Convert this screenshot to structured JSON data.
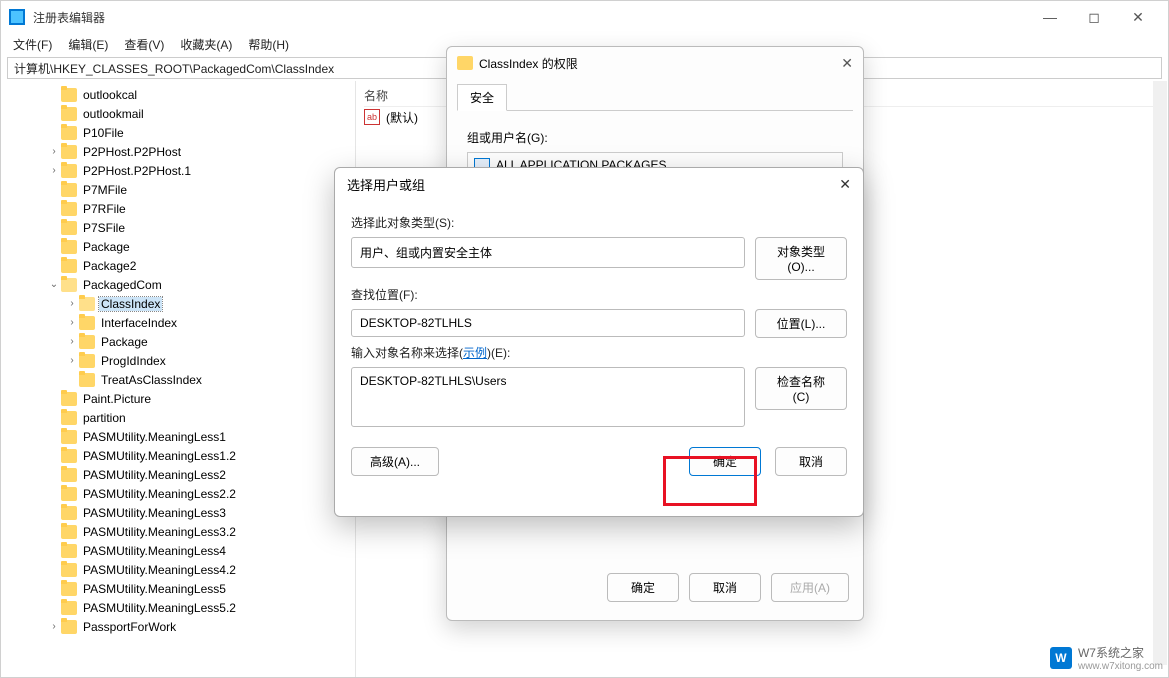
{
  "window": {
    "title": "注册表编辑器",
    "minimize": "—",
    "maximize": "◻",
    "close": "✕"
  },
  "menu": {
    "file": "文件(F)",
    "edit": "编辑(E)",
    "view": "查看(V)",
    "favorites": "收藏夹(A)",
    "help": "帮助(H)"
  },
  "address": "计算机\\HKEY_CLASSES_ROOT\\PackagedCom\\ClassIndex",
  "tree": [
    {
      "indent": 2,
      "exp": "",
      "label": "outlookcal"
    },
    {
      "indent": 2,
      "exp": "",
      "label": "outlookmail"
    },
    {
      "indent": 2,
      "exp": "",
      "label": "P10File"
    },
    {
      "indent": 2,
      "exp": ">",
      "label": "P2PHost.P2PHost"
    },
    {
      "indent": 2,
      "exp": ">",
      "label": "P2PHost.P2PHost.1"
    },
    {
      "indent": 2,
      "exp": "",
      "label": "P7MFile"
    },
    {
      "indent": 2,
      "exp": "",
      "label": "P7RFile"
    },
    {
      "indent": 2,
      "exp": "",
      "label": "P7SFile"
    },
    {
      "indent": 2,
      "exp": "",
      "label": "Package"
    },
    {
      "indent": 2,
      "exp": "",
      "label": "Package2"
    },
    {
      "indent": 2,
      "exp": "v",
      "label": "PackagedCom",
      "open": true
    },
    {
      "indent": 3,
      "exp": ">",
      "label": "ClassIndex",
      "selected": true,
      "open": true
    },
    {
      "indent": 3,
      "exp": ">",
      "label": "InterfaceIndex"
    },
    {
      "indent": 3,
      "exp": ">",
      "label": "Package"
    },
    {
      "indent": 3,
      "exp": ">",
      "label": "ProgIdIndex"
    },
    {
      "indent": 3,
      "exp": "",
      "label": "TreatAsClassIndex"
    },
    {
      "indent": 2,
      "exp": "",
      "label": "Paint.Picture"
    },
    {
      "indent": 2,
      "exp": "",
      "label": "partition"
    },
    {
      "indent": 2,
      "exp": "",
      "label": "PASMUtility.MeaningLess1"
    },
    {
      "indent": 2,
      "exp": "",
      "label": "PASMUtility.MeaningLess1.2"
    },
    {
      "indent": 2,
      "exp": "",
      "label": "PASMUtility.MeaningLess2"
    },
    {
      "indent": 2,
      "exp": "",
      "label": "PASMUtility.MeaningLess2.2"
    },
    {
      "indent": 2,
      "exp": "",
      "label": "PASMUtility.MeaningLess3"
    },
    {
      "indent": 2,
      "exp": "",
      "label": "PASMUtility.MeaningLess3.2"
    },
    {
      "indent": 2,
      "exp": "",
      "label": "PASMUtility.MeaningLess4"
    },
    {
      "indent": 2,
      "exp": "",
      "label": "PASMUtility.MeaningLess4.2"
    },
    {
      "indent": 2,
      "exp": "",
      "label": "PASMUtility.MeaningLess5"
    },
    {
      "indent": 2,
      "exp": "",
      "label": "PASMUtility.MeaningLess5.2"
    },
    {
      "indent": 2,
      "exp": ">",
      "label": "PassportForWork"
    }
  ],
  "values": {
    "header_name": "名称",
    "default_name": "(默认)",
    "icon_text": "ab"
  },
  "perm_dialog": {
    "title": "ClassIndex 的权限",
    "close": "✕",
    "tab_security": "安全",
    "group_label": "组或用户名(G):",
    "group_item": "ALL APPLICATION PACKAGES",
    "btn_ok": "确定",
    "btn_cancel": "取消",
    "btn_apply": "应用(A)"
  },
  "sel_dialog": {
    "title": "选择用户或组",
    "close": "✕",
    "label_type": "选择此对象类型(S):",
    "value_type": "用户、组或内置安全主体",
    "btn_type": "对象类型(O)...",
    "label_location": "查找位置(F):",
    "value_location": "DESKTOP-82TLHLS",
    "btn_location": "位置(L)...",
    "label_names_pre": "输入对象名称来选择(",
    "label_names_link": "示例",
    "label_names_post": ")(E):",
    "value_names": "DESKTOP-82TLHLS\\Users",
    "btn_check": "检查名称(C)",
    "btn_advanced": "高级(A)...",
    "btn_ok": "确定",
    "btn_cancel": "取消"
  },
  "watermark": {
    "brand": "W7系统之家",
    "url": "www.w7xitong.com"
  }
}
